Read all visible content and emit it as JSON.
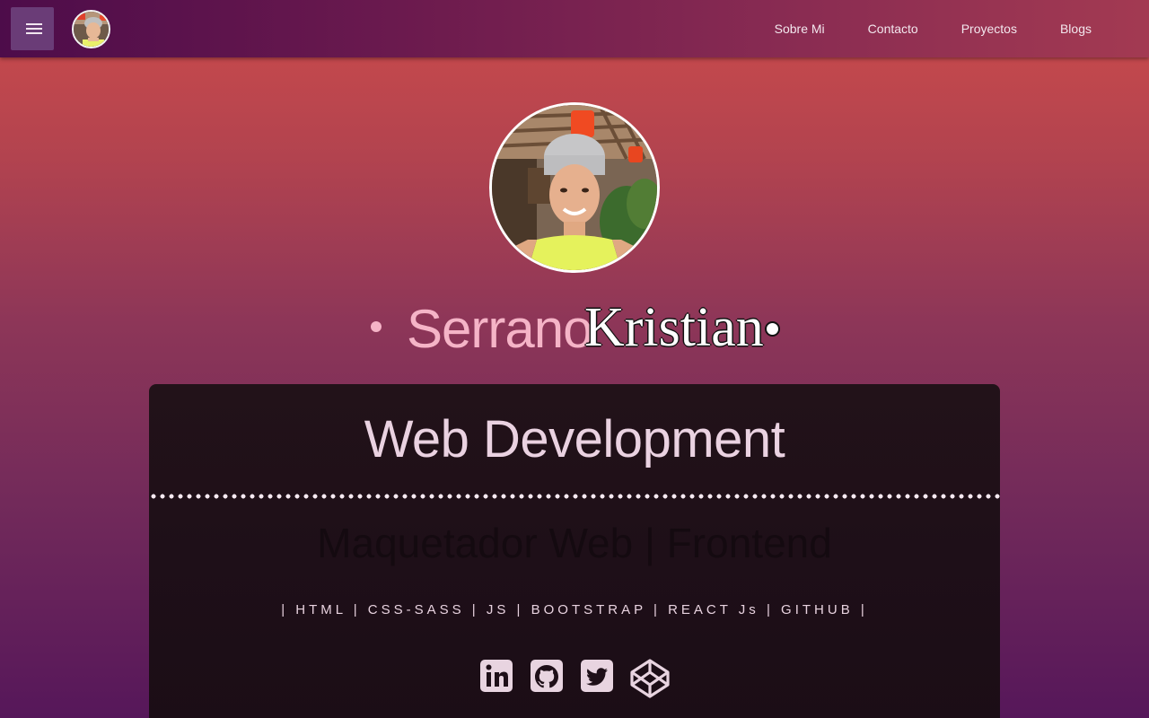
{
  "nav": {
    "menu_icon": "hamburger-icon",
    "avatar_icon": "profile-photo",
    "links": [
      {
        "label": "Sobre Mi"
      },
      {
        "label": "Contacto"
      },
      {
        "label": "Proyectos"
      },
      {
        "label": "Blogs"
      }
    ]
  },
  "hero": {
    "avatar_icon": "profile-photo",
    "first_name": "Serrano",
    "last_name": "Kristian"
  },
  "card": {
    "title": "Web Development",
    "subtitle": "Maquetador Web | Frontend",
    "skills": "| HTML | CSS-SASS | JS | BOOTSTRAP | REACT Js | GITHUB |",
    "socials": [
      {
        "icon": "linkedin-icon"
      },
      {
        "icon": "github-icon"
      },
      {
        "icon": "twitter-icon"
      },
      {
        "icon": "codepen-icon"
      }
    ]
  },
  "colors": {
    "accent_pink": "#f5b4c7",
    "card_bg": "#1e0f18",
    "nav_bg": "#6b1a4e"
  }
}
